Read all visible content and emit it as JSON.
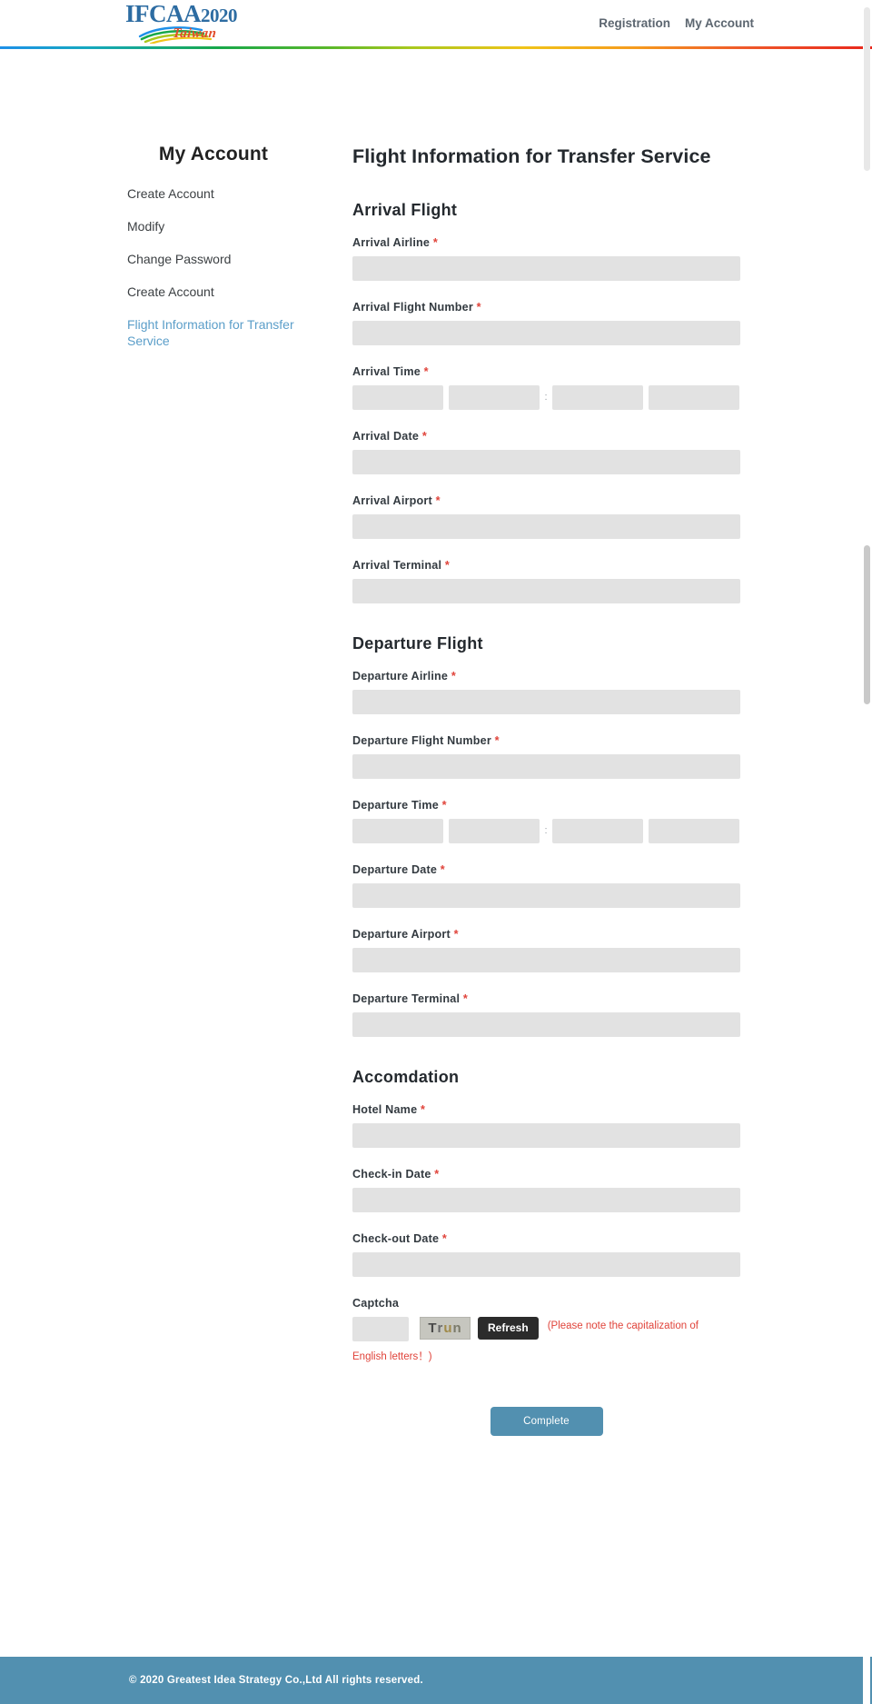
{
  "header": {
    "logo": {
      "brand": "IFCAA",
      "year": "2020",
      "sub": "Taiwan"
    },
    "nav": [
      {
        "label": "Registration",
        "name": "nav-registration"
      },
      {
        "label": "My Account",
        "name": "nav-my-account"
      }
    ]
  },
  "sidebar": {
    "title": "My Account",
    "items": [
      {
        "label": "Create Account",
        "active": false
      },
      {
        "label": "Modify",
        "active": false
      },
      {
        "label": "Change Password",
        "active": false
      },
      {
        "label": "Create Account",
        "active": false
      },
      {
        "label": "Flight Information for Transfer Service",
        "active": true
      }
    ]
  },
  "main": {
    "title": "Flight Information for Transfer Service",
    "sections": [
      {
        "title": "Arrival Flight",
        "fields": [
          {
            "label": "Arrival Airline",
            "required": "*",
            "type": "text",
            "value": "",
            "placeholder": ""
          },
          {
            "label": "Arrival Flight Number",
            "required": "*",
            "type": "text",
            "value": "",
            "placeholder": ""
          },
          {
            "label": "Arrival Time",
            "required": "*",
            "type": "time",
            "separator": ":",
            "value": "",
            "placeholder": ""
          },
          {
            "label": "Arrival Date",
            "required": "*",
            "type": "text",
            "value": "",
            "placeholder": ""
          },
          {
            "label": "Arrival Airport",
            "required": "*",
            "type": "text",
            "value": "",
            "placeholder": ""
          },
          {
            "label": "Arrival Terminal",
            "required": "*",
            "type": "text",
            "value": "",
            "placeholder": ""
          }
        ]
      },
      {
        "title": "Departure Flight",
        "fields": [
          {
            "label": "Departure Airline",
            "required": "*",
            "type": "text",
            "value": "",
            "placeholder": ""
          },
          {
            "label": "Departure Flight Number",
            "required": "*",
            "type": "text",
            "value": "",
            "placeholder": ""
          },
          {
            "label": "Departure Time",
            "required": "*",
            "type": "time",
            "separator": ":",
            "value": "",
            "placeholder": ""
          },
          {
            "label": "Departure Date",
            "required": "*",
            "type": "text",
            "value": "",
            "placeholder": ""
          },
          {
            "label": "Departure Airport",
            "required": "*",
            "type": "text",
            "value": "",
            "placeholder": ""
          },
          {
            "label": "Departure Terminal",
            "required": "*",
            "type": "text",
            "value": "",
            "placeholder": ""
          }
        ]
      },
      {
        "title": "Accomdation",
        "fields": [
          {
            "label": "Hotel Name",
            "required": "*",
            "type": "text",
            "value": "",
            "placeholder": ""
          },
          {
            "label": "Check-in Date",
            "required": "*",
            "type": "text",
            "value": "",
            "placeholder": ""
          },
          {
            "label": "Check-out Date",
            "required": "*",
            "type": "text",
            "value": "",
            "placeholder": ""
          }
        ]
      }
    ],
    "captcha": {
      "label": "Captcha",
      "value": "",
      "placeholder": "",
      "image_text": "Trun",
      "refresh_label": "Refresh",
      "note_line1": "(Please note the capitalization of",
      "note_line2": "English letters！)"
    },
    "submit_label": "Complete"
  },
  "footer": {
    "copyright": "© 2020 Greatest Idea Strategy Co.,Ltd All rights reserved."
  },
  "colors": {
    "accent": "#5290b0",
    "link": "#5b9ec9",
    "required": "#e0433a",
    "input_bg": "#e2e2e2",
    "logo_blue": "#2d6ca2",
    "logo_red": "#e24b2a"
  }
}
